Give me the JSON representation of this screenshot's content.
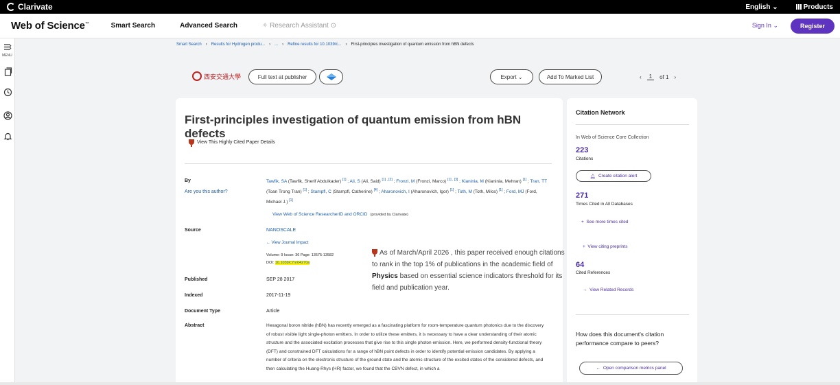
{
  "topbar": {
    "brand": "Clarivate",
    "language": "English ⌄",
    "products": "Products"
  },
  "nav": {
    "logo": "Web of Science",
    "logo_tm": "™",
    "smart_search": "Smart Search",
    "advanced_search": "Advanced Search",
    "research_assistant": "✧ Research Assistant ⊙",
    "sign_in": "Sign In ⌄",
    "register": "Register"
  },
  "rail": {
    "menu_label": "MENU"
  },
  "breadcrumb": {
    "items": [
      "Smart Search",
      "Results for Hydrogen produ...",
      "...",
      "Refine results for 10.1039/c...",
      "First-principles investigation of quantum emission from hBN defects"
    ],
    "sep": "›"
  },
  "actions": {
    "university": "西安交通大學",
    "full_text": "Full text at publisher",
    "export": "Export ⌄",
    "add_marked": "Add To Marked List",
    "page_num": "1",
    "page_of": "of 1"
  },
  "record": {
    "title": "First-principles investigation of quantum emission from hBN defects",
    "highly_cited": "View This Highly Cited Paper Details",
    "by_label": "By",
    "are_you": "Are you this author?",
    "authors": [
      {
        "name": "Tawfik, SA",
        "full": "(Tawfik, Sherif Abdulkader)",
        "aff": "[1]"
      },
      {
        "name": "Ali, S",
        "full": "(Ali, Said)",
        "aff": "[1] , [2]"
      },
      {
        "name": "Fronzi, M",
        "full": "(Fronzi, Marco)",
        "aff": "[1] , [3]"
      },
      {
        "name": "Kianinia, M",
        "full": "(Kianinia, Mehran)",
        "aff": "[1]"
      },
      {
        "name": "Tran, TT",
        "full": "(Toan Trong Tran)",
        "aff": "[1]"
      },
      {
        "name": "Stampfl, C",
        "full": "(Stampfl, Catherine)",
        "aff": "[4]"
      },
      {
        "name": "Aharonovich, I",
        "full": "(Aharonovich, Igor)",
        "aff": "[1]"
      },
      {
        "name": "Toth, M",
        "full": "(Toth, Milos)",
        "aff": "[1]"
      },
      {
        "name": "Ford, MJ",
        "full": "(Ford, Michael J.)",
        "aff": "[1]"
      }
    ],
    "researcher_id": "View Web of Science ResearcherID and ORCID",
    "provided_by": "(provided by Clarivate)",
    "source_label": "Source",
    "journal": "NANOSCALE",
    "journal_impact": "View Journal Impact",
    "volume_line": "Volume: 9    Issue: 36    Page: 13575-13582",
    "doi_label": "DOI:",
    "doi": "10.1039/c7nr04270a",
    "published_label": "Published",
    "published": "SEP 28 2017",
    "indexed_label": "Indexed",
    "indexed": "2017-11-19",
    "doctype_label": "Document Type",
    "doctype": "Article",
    "abstract_label": "Abstract",
    "abstract": "Hexagonal boron nitride (hBN) has recently emerged as a fascinating platform for room-temperature quantum photonics due to the discovery of robust visible light single-photon emitters. In order to utilize these emitters, it is necessary to have a clear understanding of their atomic structure and the associated excitation processes that give rise to this single photon emission. Here, we performed density-functional theory (DFT) and constrained DFT calculations for a range of hBN point defects in order to identify potential emission candidates. By applying a number of criteria on the electronic structure of the ground state and the atomic structure of the excited states of the considered defects, and then calculating the Huang-Rhys (HR) factor, we found that the CBVN defect, in which a"
  },
  "popup": {
    "before": "As of March/April 2026 , this paper received enough citations to rank in the top 1% of publications in the academic field of ",
    "field": "Physics",
    "after": " based on essential science indicators threshold for its field and publication year."
  },
  "citation": {
    "title": "Citation Network",
    "collection": "In Web of Science Core Collection",
    "citations_count": "223",
    "citations_label": "Citations",
    "create_alert": "Create citation alert",
    "times_cited_count": "271",
    "times_cited_label": "Times Cited in All Databases",
    "see_more": "See more times cited",
    "view_preprints": "View citing preprints",
    "cited_refs_count": "64",
    "cited_refs_label": "Cited References",
    "view_related": "View Related Records",
    "question": "How does this document's citation performance compare to peers?",
    "open_panel": "Open comparison metrics panel"
  }
}
